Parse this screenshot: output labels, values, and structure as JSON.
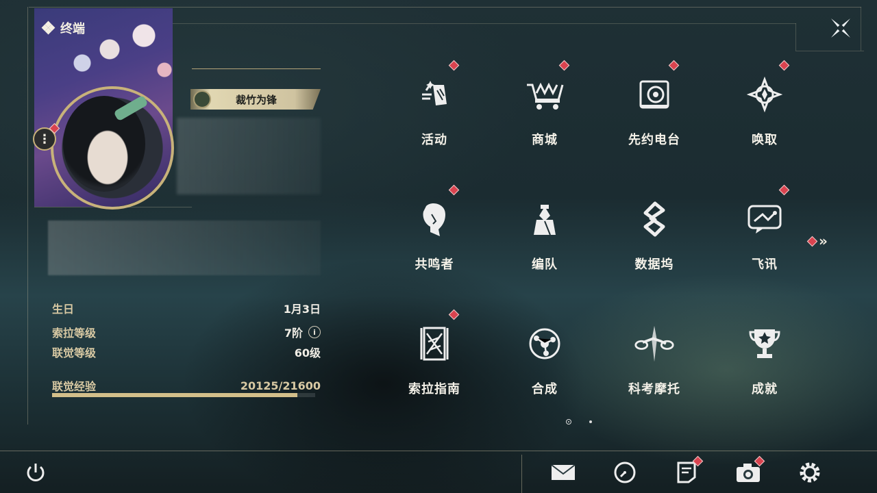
{
  "header": {
    "label": "终端"
  },
  "profile": {
    "title_badge": "裁竹为锋"
  },
  "info": {
    "birthday_label": "生日",
    "birthday_value": "1月3日",
    "sola_level_label": "索拉等级",
    "sola_level_value": "7阶",
    "sola_level_info_icon": "i",
    "union_level_label": "联觉等级",
    "union_level_value": "60级",
    "union_exp_label": "联觉经验",
    "union_exp_value": "20125/21600",
    "union_exp_fraction": 0.932
  },
  "menu": {
    "tiles": [
      {
        "label": "活动",
        "icon": "activity-icon",
        "badge": true
      },
      {
        "label": "商城",
        "icon": "shop-icon",
        "badge": true
      },
      {
        "label": "先约电台",
        "icon": "radio-icon",
        "badge": true
      },
      {
        "label": "唤取",
        "icon": "summon-icon",
        "badge": true
      },
      {
        "label": "共鸣者",
        "icon": "resonator-icon",
        "badge": true
      },
      {
        "label": "编队",
        "icon": "team-icon",
        "badge": false
      },
      {
        "label": "数据坞",
        "icon": "data-dock-icon",
        "badge": false
      },
      {
        "label": "飞讯",
        "icon": "message-icon",
        "badge": true
      },
      {
        "label": "索拉指南",
        "icon": "guide-icon",
        "badge": true
      },
      {
        "label": "合成",
        "icon": "synthesis-icon",
        "badge": false
      },
      {
        "label": "科考摩托",
        "icon": "motorcycle-icon",
        "badge": false
      },
      {
        "label": "成就",
        "icon": "achievement-icon",
        "badge": false
      }
    ],
    "more_icon": "double-chevron-right-icon"
  },
  "colors": {
    "accent_gold": "#c8b27a",
    "badge_red": "#d9434f",
    "text_light": "#f4f1e8"
  },
  "bottom_bar": {
    "icons": [
      "power-icon",
      "mail-icon",
      "clock-icon",
      "notes-icon",
      "camera-icon",
      "settings-icon"
    ]
  }
}
